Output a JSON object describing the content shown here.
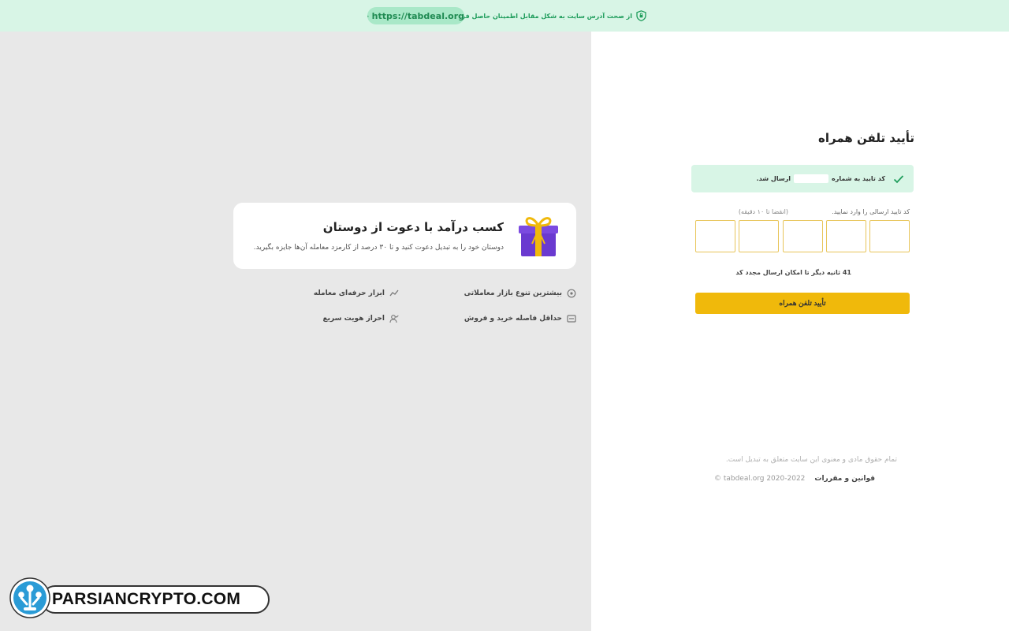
{
  "banner": {
    "notice": "از صحت آدرس سایت به شکل مقابل اطمینان حاصل فرمایید",
    "url": "https://tabdeal.org"
  },
  "promo": {
    "title": "کسب درآمد با دعوت از دوستان",
    "description": "دوستان خود را به تبدیل دعوت کنید و تا ۳۰ درصد از کارمزد معامله آن‌ها جایزه بگیرید."
  },
  "features": [
    {
      "label": "بیشترین تنوع بازار معاملاتی",
      "icon": "market-icon"
    },
    {
      "label": "ابزار حرفه‌ای معامله",
      "icon": "chart-line-icon"
    },
    {
      "label": "حداقل فاصله خرید و فروش",
      "icon": "spread-icon"
    },
    {
      "label": "احراز هویت سریع",
      "icon": "user-check-icon"
    }
  ],
  "verify": {
    "title": "تأیید تلفن همراه",
    "alert_prefix": "کد تایید به شماره",
    "alert_suffix": "ارسال شد.",
    "code_label": "کد تایید ارسالی را وارد نمایید.",
    "code_hint": "(انقضا تا ۱۰ دقیقه)",
    "code_digits": [
      "",
      "",
      "",
      "",
      ""
    ],
    "timer_seconds": "41",
    "timer_text": "ثانیه دیگر تا امکان ارسال مجدد کد",
    "confirm_label": "تأیید تلفن همراه"
  },
  "footer": {
    "copyright_note": "تمام حقوق مادی و معنوی این سایت متعلق به تبدیل است.",
    "terms": "قوانین و مقررات",
    "copyright": "© tabdeal.org 2020-2022"
  },
  "watermark": {
    "text": "PARSIANCRYPTO.COM"
  },
  "colors": {
    "accent": "#f0b90b",
    "success": "#1f9d5c",
    "banner_bg": "#d8f5e6",
    "gift": "#6a3ad0"
  }
}
